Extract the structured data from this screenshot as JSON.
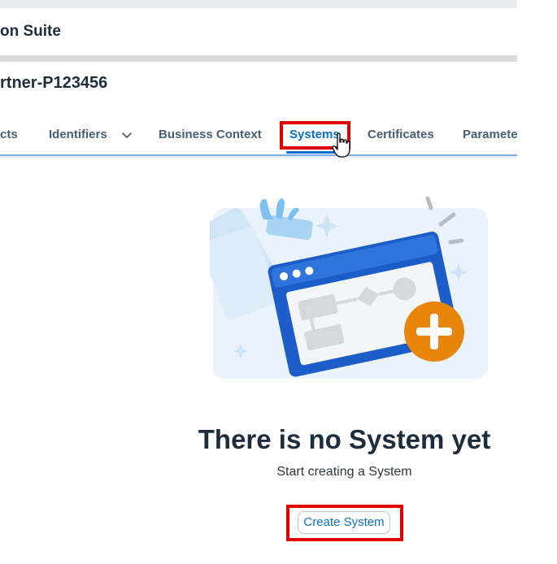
{
  "shell": {
    "app_title": "on Suite"
  },
  "header": {
    "object_title": "rtner-P123456"
  },
  "tabs": [
    {
      "label": "cts"
    },
    {
      "label": "Identifiers"
    },
    {
      "label": "Business Context"
    },
    {
      "label": "Systems"
    },
    {
      "label": "Certificates"
    },
    {
      "label": "Paramete"
    }
  ],
  "active_tab": "Systems",
  "empty_state": {
    "title": "There is no System yet",
    "subtitle": "Start creating a System",
    "button_label": "Create System"
  },
  "colors": {
    "accent": "#0a6ed1",
    "highlight_box": "#e00000",
    "plus_badge": "#e9850b",
    "illustration_bg": "#eaf3fb"
  },
  "icons": [
    "chevron-down-icon",
    "hand-pointer-cursor-icon",
    "plus-icon"
  ]
}
